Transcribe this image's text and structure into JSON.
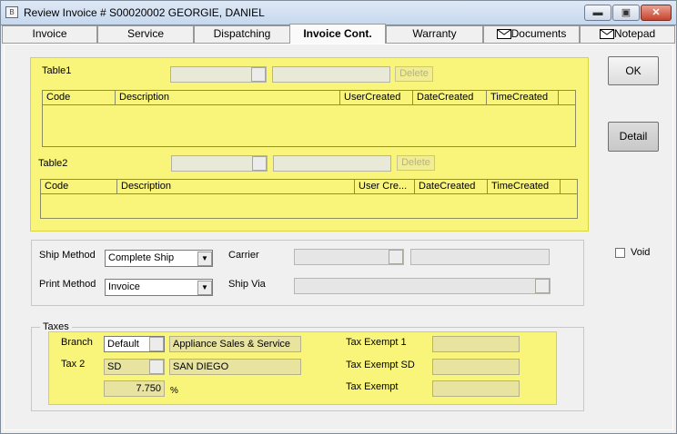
{
  "window": {
    "icon": "B",
    "title": "Review Invoice # S00020002   GEORGIE, DANIEL",
    "min": "▬",
    "max": "▣",
    "close": "✕"
  },
  "tabs": [
    {
      "label": "Invoice"
    },
    {
      "label": "Service"
    },
    {
      "label": "Dispatching"
    },
    {
      "label": "Invoice Cont."
    },
    {
      "label": "Warranty"
    },
    {
      "label": "Documents",
      "icon": "envelope-icon"
    },
    {
      "label": "Notepad",
      "icon": "envelope-icon"
    }
  ],
  "table1": {
    "label": "Table1",
    "delete_label": "Delete",
    "columns": [
      "Code",
      "Description",
      "UserCreated",
      "DateCreated",
      "TimeCreated"
    ]
  },
  "table2": {
    "label": "Table2",
    "delete_label": "Delete",
    "columns": [
      "Code",
      "Description",
      "User Cre...",
      "DateCreated",
      "TimeCreated"
    ]
  },
  "shipping": {
    "ship_method_label": "Ship Method",
    "ship_method_value": "Complete Ship",
    "carrier_label": "Carrier",
    "print_method_label": "Print Method",
    "print_method_value": "Invoice",
    "ship_via_label": "Ship Via"
  },
  "taxes": {
    "group_label": "Taxes",
    "branch_label": "Branch",
    "branch_code": "Default",
    "branch_name": "Appliance Sales & Service",
    "tax2_label": "Tax 2",
    "tax2_code": "SD",
    "tax2_name": "SAN DIEGO",
    "rate": "7.750",
    "rate_unit": "%",
    "tax_exempt_1_label": "Tax Exempt 1",
    "tax_exempt_sd_label": "Tax Exempt SD",
    "tax_exempt_label": "Tax Exempt"
  },
  "buttons": {
    "ok": "OK",
    "detail": "Detail"
  },
  "void_label": "Void"
}
